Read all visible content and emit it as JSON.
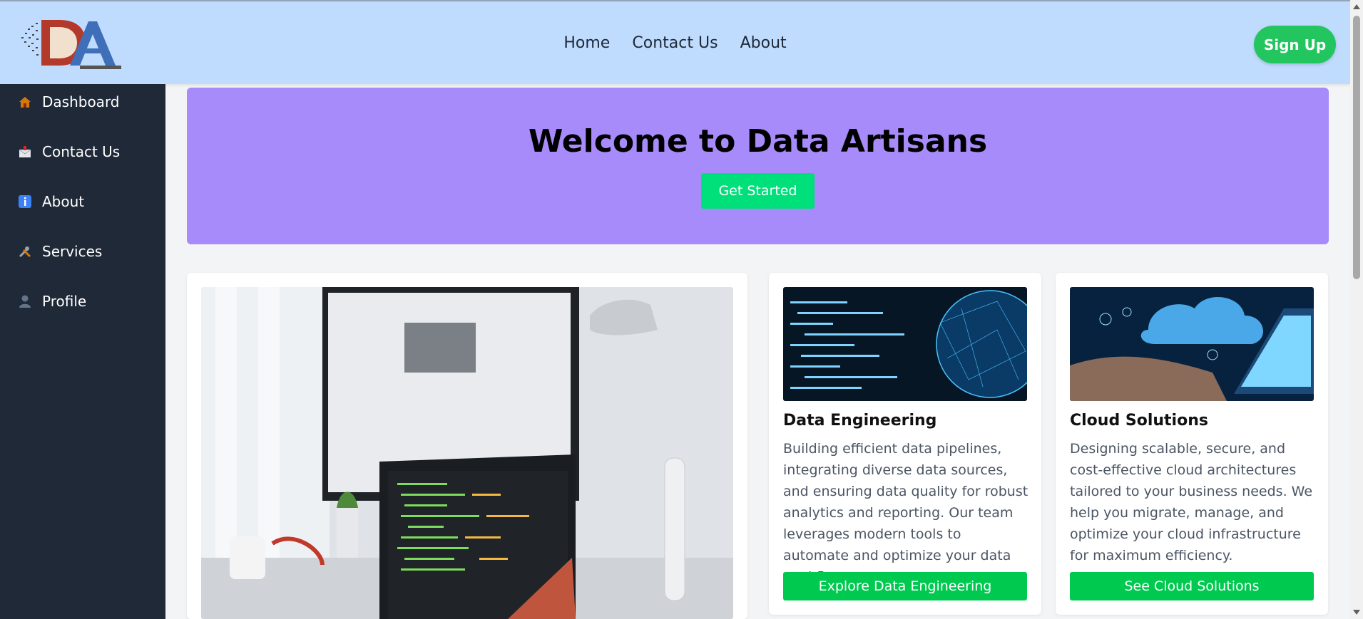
{
  "header": {
    "logo_text": "DA",
    "nav": [
      "Home",
      "Contact Us",
      "About"
    ],
    "signup_label": "Sign Up"
  },
  "sidebar": {
    "items": [
      {
        "label": "Dashboard",
        "icon": "house-icon"
      },
      {
        "label": "Contact Us",
        "icon": "inbox-icon"
      },
      {
        "label": "About",
        "icon": "info-icon"
      },
      {
        "label": "Services",
        "icon": "tools-icon"
      },
      {
        "label": "Profile",
        "icon": "user-icon"
      }
    ]
  },
  "hero": {
    "title": "Welcome to Data Artisans",
    "cta_label": "Get Started"
  },
  "cards": [
    {
      "title": "Data Engineering",
      "description": "Building efficient data pipelines, integrating diverse data sources, and ensuring data quality for robust analytics and reporting. Our team leverages modern tools to automate and optimize your data workflows.",
      "button_label": "Explore Data Engineering"
    },
    {
      "title": "Cloud Solutions",
      "description": "Designing scalable, secure, and cost-effective cloud architectures tailored to your business needs. We help you migrate, manage, and optimize your cloud infrastructure for maximum efficiency.",
      "button_label": "See Cloud Solutions"
    }
  ],
  "colors": {
    "header_bg": "#bfdbfe",
    "sidebar_bg": "#1f2937",
    "hero_bg": "#a78bfa",
    "accent_green": "#00c950"
  }
}
